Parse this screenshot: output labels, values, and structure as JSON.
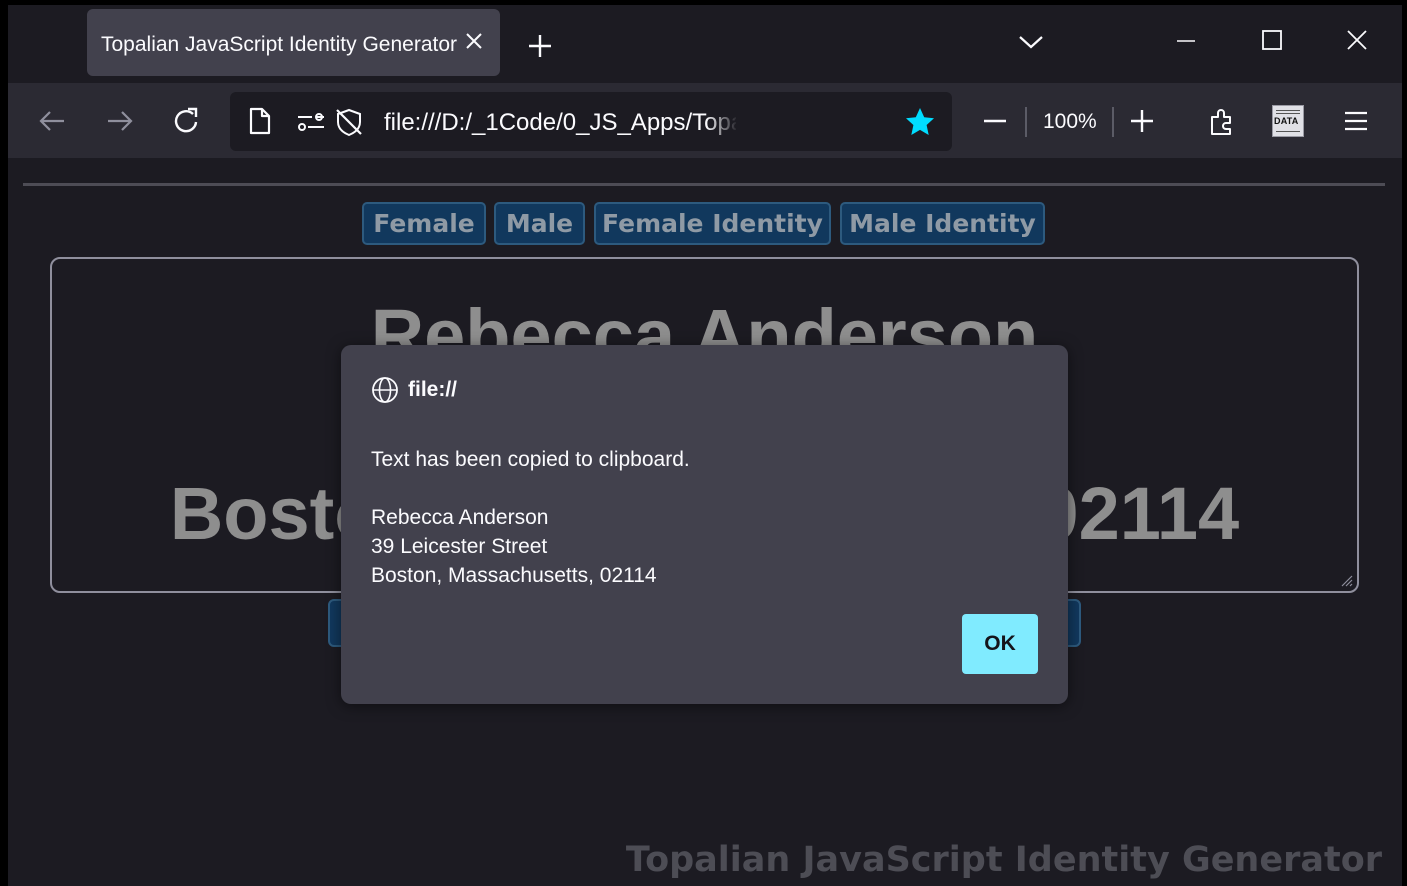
{
  "browser": {
    "tab_title": "Topalian JavaScript Identity Generator",
    "url": "file:///D:/_1Code/0_JS_Apps/Topalian_JavaScript_Identity_Generator/index.html",
    "zoom_level": "100%",
    "extension_label": "DATA",
    "accent_color": "#00ddff"
  },
  "page": {
    "buttons": [
      "Female",
      "Male",
      "Female Identity",
      "Male Identity"
    ],
    "identity": {
      "name": "Rebecca Anderson",
      "street": "39 Leicester Street",
      "city": "Boston, Massachusetts, 02114"
    },
    "footer_title": "Topalian JavaScript Identity Generator"
  },
  "dialog": {
    "origin": "file://",
    "message": "Text has been copied to clipboard.",
    "lines": [
      "Rebecca Anderson",
      "39 Leicester Street",
      "Boston, Massachusetts, 02114"
    ],
    "ok_label": "OK",
    "ok_color": "#80ebff"
  }
}
